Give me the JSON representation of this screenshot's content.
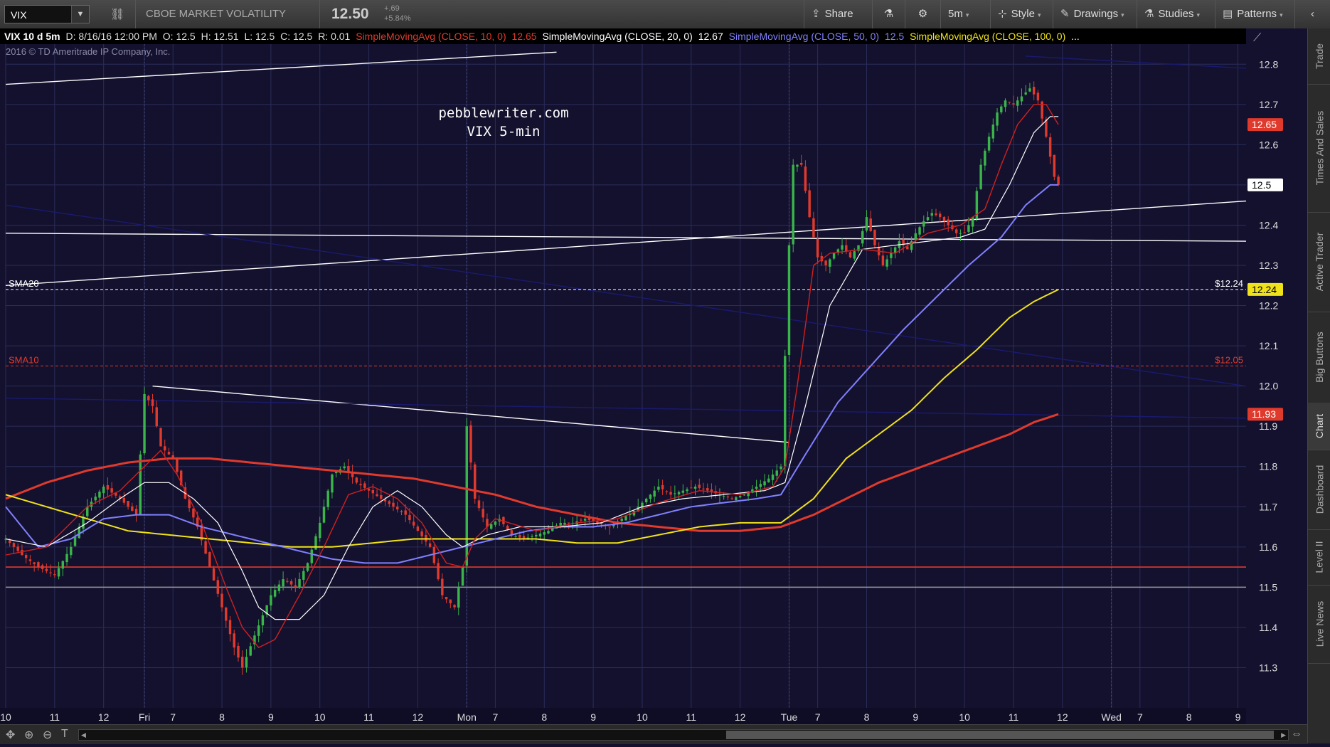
{
  "toolbar": {
    "symbol": "VIX",
    "description": "CBOE MARKET VOLATILITY INDEX",
    "price": "12.50",
    "change": "+.69",
    "change_pct": "+5.84%",
    "buttons": [
      {
        "label": "Share",
        "icon": "share-icon"
      },
      {
        "label": "",
        "icon": "flask-icon"
      },
      {
        "label": "",
        "icon": "gear-icon"
      },
      {
        "label": "5m",
        "icon": ""
      },
      {
        "label": "Style",
        "icon": "style-icon"
      },
      {
        "label": "Drawings",
        "icon": "pencil-icon"
      },
      {
        "label": "Studies",
        "icon": "flask-icon"
      },
      {
        "label": "Patterns",
        "icon": "patterns-icon"
      }
    ]
  },
  "infobar": {
    "symbol_period": "VIX 10 d 5m",
    "date": "D: 8/16/16 12:00 PM",
    "open": "O: 12.5",
    "high": "H: 12.51",
    "low": "L: 12.5",
    "close": "C: 12.5",
    "range": "R: 0.01",
    "sma10_label": "SimpleMovingAvg (CLOSE, 10, 0)",
    "sma10_value": "12.65",
    "sma20_label": "SimpleMovingAvg (CLOSE, 20, 0)",
    "sma20_value": "12.67",
    "sma50_label": "SimpleMovingAvg (CLOSE, 50, 0)",
    "sma50_value": "12.5",
    "sma100_label": "SimpleMovingAvg (CLOSE, 100, 0)",
    "sma100_value": "..."
  },
  "copyright": "2016 © TD Ameritrade IP Company, Inc.",
  "watermark": [
    "pebblewriter.com",
    "VIX 5-min"
  ],
  "right_rail_tabs": [
    "Trade",
    "Times And Sales",
    "Active Trader",
    "Big Buttons",
    "Chart",
    "Dashboard",
    "Level II",
    "Live News"
  ],
  "active_rail_tab": "Chart",
  "chart_data": {
    "type": "candlestick",
    "symbol": "VIX",
    "interval": "5m",
    "ylim": [
      11.2,
      12.85
    ],
    "yticks": [
      11.3,
      11.4,
      11.5,
      11.6,
      11.7,
      11.8,
      11.9,
      12.0,
      12.1,
      12.2,
      12.3,
      12.4,
      12.5,
      12.6,
      12.7,
      12.8
    ],
    "x_ticks": [
      {
        "label": "10",
        "i": 0
      },
      {
        "label": "11",
        "i": 12
      },
      {
        "label": "12",
        "i": 24
      },
      {
        "label": "Fri",
        "i": 34
      },
      {
        "label": "7",
        "i": 41
      },
      {
        "label": "8",
        "i": 53
      },
      {
        "label": "9",
        "i": 65
      },
      {
        "label": "10",
        "i": 77
      },
      {
        "label": "11",
        "i": 89
      },
      {
        "label": "12",
        "i": 101
      },
      {
        "label": "Mon",
        "i": 113
      },
      {
        "label": "7",
        "i": 120
      },
      {
        "label": "8",
        "i": 132
      },
      {
        "label": "9",
        "i": 144
      },
      {
        "label": "10",
        "i": 156
      },
      {
        "label": "11",
        "i": 168
      },
      {
        "label": "12",
        "i": 180
      },
      {
        "label": "Tue",
        "i": 192
      },
      {
        "label": "7",
        "i": 199
      },
      {
        "label": "8",
        "i": 211
      },
      {
        "label": "9",
        "i": 223
      },
      {
        "label": "10",
        "i": 235
      },
      {
        "label": "11",
        "i": 247
      },
      {
        "label": "12",
        "i": 259
      },
      {
        "label": "Wed",
        "i": 271
      },
      {
        "label": "7",
        "i": 278
      },
      {
        "label": "8",
        "i": 290
      },
      {
        "label": "9",
        "i": 302
      }
    ],
    "x_max": 304,
    "session_breaks": [
      34,
      113,
      192,
      271
    ],
    "close_anchors": [
      [
        0,
        11.62
      ],
      [
        4,
        11.58
      ],
      [
        8,
        11.55
      ],
      [
        12,
        11.53
      ],
      [
        16,
        11.6
      ],
      [
        20,
        11.7
      ],
      [
        24,
        11.75
      ],
      [
        28,
        11.72
      ],
      [
        32,
        11.68
      ],
      [
        34,
        11.98
      ],
      [
        36,
        11.95
      ],
      [
        38,
        11.85
      ],
      [
        41,
        11.82
      ],
      [
        44,
        11.72
      ],
      [
        47,
        11.65
      ],
      [
        50,
        11.55
      ],
      [
        53,
        11.45
      ],
      [
        56,
        11.35
      ],
      [
        58,
        11.3
      ],
      [
        61,
        11.38
      ],
      [
        65,
        11.48
      ],
      [
        68,
        11.52
      ],
      [
        71,
        11.5
      ],
      [
        74,
        11.56
      ],
      [
        77,
        11.66
      ],
      [
        80,
        11.78
      ],
      [
        83,
        11.8
      ],
      [
        86,
        11.76
      ],
      [
        89,
        11.74
      ],
      [
        92,
        11.72
      ],
      [
        95,
        11.7
      ],
      [
        98,
        11.68
      ],
      [
        101,
        11.64
      ],
      [
        104,
        11.6
      ],
      [
        107,
        11.48
      ],
      [
        110,
        11.45
      ],
      [
        112,
        11.55
      ],
      [
        113,
        11.9
      ],
      [
        115,
        11.72
      ],
      [
        118,
        11.65
      ],
      [
        121,
        11.67
      ],
      [
        124,
        11.63
      ],
      [
        127,
        11.62
      ],
      [
        130,
        11.63
      ],
      [
        133,
        11.64
      ],
      [
        136,
        11.66
      ],
      [
        139,
        11.66
      ],
      [
        142,
        11.67
      ],
      [
        145,
        11.66
      ],
      [
        148,
        11.65
      ],
      [
        151,
        11.67
      ],
      [
        154,
        11.69
      ],
      [
        157,
        11.72
      ],
      [
        160,
        11.75
      ],
      [
        163,
        11.73
      ],
      [
        166,
        11.74
      ],
      [
        169,
        11.75
      ],
      [
        172,
        11.74
      ],
      [
        175,
        11.73
      ],
      [
        178,
        11.72
      ],
      [
        181,
        11.73
      ],
      [
        184,
        11.75
      ],
      [
        187,
        11.77
      ],
      [
        190,
        11.8
      ],
      [
        192,
        12.35
      ],
      [
        193,
        12.55
      ],
      [
        195,
        12.55
      ],
      [
        197,
        12.42
      ],
      [
        199,
        12.32
      ],
      [
        201,
        12.3
      ],
      [
        203,
        12.33
      ],
      [
        205,
        12.35
      ],
      [
        207,
        12.32
      ],
      [
        209,
        12.35
      ],
      [
        211,
        12.42
      ],
      [
        213,
        12.35
      ],
      [
        215,
        12.3
      ],
      [
        217,
        12.33
      ],
      [
        219,
        12.36
      ],
      [
        221,
        12.34
      ],
      [
        223,
        12.38
      ],
      [
        225,
        12.41
      ],
      [
        227,
        12.43
      ],
      [
        229,
        12.42
      ],
      [
        231,
        12.4
      ],
      [
        233,
        12.38
      ],
      [
        235,
        12.38
      ],
      [
        237,
        12.42
      ],
      [
        239,
        12.55
      ],
      [
        241,
        12.62
      ],
      [
        243,
        12.68
      ],
      [
        245,
        12.71
      ],
      [
        247,
        12.7
      ],
      [
        249,
        12.72
      ],
      [
        251,
        12.74
      ],
      [
        253,
        12.71
      ],
      [
        255,
        12.62
      ],
      [
        257,
        12.52
      ],
      [
        258,
        12.5
      ]
    ],
    "sma10_anchors": [
      [
        0,
        11.58
      ],
      [
        10,
        11.6
      ],
      [
        20,
        11.7
      ],
      [
        28,
        11.74
      ],
      [
        34,
        11.8
      ],
      [
        38,
        11.84
      ],
      [
        42,
        11.78
      ],
      [
        48,
        11.66
      ],
      [
        54,
        11.5
      ],
      [
        58,
        11.4
      ],
      [
        62,
        11.35
      ],
      [
        66,
        11.37
      ],
      [
        72,
        11.48
      ],
      [
        78,
        11.6
      ],
      [
        84,
        11.73
      ],
      [
        90,
        11.75
      ],
      [
        96,
        11.72
      ],
      [
        102,
        11.66
      ],
      [
        108,
        11.56
      ],
      [
        112,
        11.55
      ],
      [
        115,
        11.62
      ],
      [
        120,
        11.67
      ],
      [
        130,
        11.64
      ],
      [
        140,
        11.66
      ],
      [
        150,
        11.67
      ],
      [
        160,
        11.71
      ],
      [
        170,
        11.74
      ],
      [
        180,
        11.73
      ],
      [
        188,
        11.75
      ],
      [
        191,
        11.8
      ],
      [
        194,
        12.0
      ],
      [
        198,
        12.3
      ],
      [
        202,
        12.33
      ],
      [
        210,
        12.34
      ],
      [
        218,
        12.33
      ],
      [
        226,
        12.38
      ],
      [
        234,
        12.4
      ],
      [
        240,
        12.44
      ],
      [
        244,
        12.55
      ],
      [
        248,
        12.65
      ],
      [
        252,
        12.7
      ],
      [
        255,
        12.7
      ],
      [
        258,
        12.65
      ]
    ],
    "sma20_anchors": [
      [
        0,
        11.62
      ],
      [
        10,
        11.6
      ],
      [
        20,
        11.66
      ],
      [
        28,
        11.72
      ],
      [
        34,
        11.76
      ],
      [
        40,
        11.76
      ],
      [
        46,
        11.72
      ],
      [
        52,
        11.66
      ],
      [
        58,
        11.54
      ],
      [
        62,
        11.45
      ],
      [
        66,
        11.42
      ],
      [
        72,
        11.42
      ],
      [
        78,
        11.48
      ],
      [
        84,
        11.6
      ],
      [
        90,
        11.7
      ],
      [
        96,
        11.74
      ],
      [
        102,
        11.7
      ],
      [
        108,
        11.63
      ],
      [
        112,
        11.6
      ],
      [
        118,
        11.63
      ],
      [
        126,
        11.65
      ],
      [
        136,
        11.65
      ],
      [
        146,
        11.66
      ],
      [
        156,
        11.7
      ],
      [
        166,
        11.72
      ],
      [
        176,
        11.73
      ],
      [
        186,
        11.74
      ],
      [
        191,
        11.76
      ],
      [
        196,
        11.95
      ],
      [
        202,
        12.2
      ],
      [
        210,
        12.34
      ],
      [
        218,
        12.35
      ],
      [
        226,
        12.36
      ],
      [
        234,
        12.37
      ],
      [
        240,
        12.39
      ],
      [
        246,
        12.5
      ],
      [
        252,
        12.63
      ],
      [
        256,
        12.67
      ],
      [
        258,
        12.67
      ]
    ],
    "sma50_anchors": [
      [
        0,
        11.7
      ],
      [
        8,
        11.6
      ],
      [
        16,
        11.62
      ],
      [
        24,
        11.67
      ],
      [
        32,
        11.68
      ],
      [
        40,
        11.68
      ],
      [
        48,
        11.65
      ],
      [
        56,
        11.63
      ],
      [
        64,
        11.61
      ],
      [
        72,
        11.59
      ],
      [
        80,
        11.57
      ],
      [
        88,
        11.56
      ],
      [
        96,
        11.56
      ],
      [
        104,
        11.58
      ],
      [
        112,
        11.6
      ],
      [
        120,
        11.62
      ],
      [
        128,
        11.64
      ],
      [
        136,
        11.65
      ],
      [
        144,
        11.65
      ],
      [
        152,
        11.66
      ],
      [
        160,
        11.68
      ],
      [
        168,
        11.7
      ],
      [
        176,
        11.71
      ],
      [
        184,
        11.72
      ],
      [
        190,
        11.73
      ],
      [
        196,
        11.83
      ],
      [
        204,
        11.96
      ],
      [
        212,
        12.05
      ],
      [
        220,
        12.14
      ],
      [
        228,
        12.22
      ],
      [
        236,
        12.3
      ],
      [
        244,
        12.37
      ],
      [
        250,
        12.45
      ],
      [
        256,
        12.5
      ],
      [
        258,
        12.5
      ]
    ],
    "sma100_anchors": [
      [
        0,
        11.73
      ],
      [
        10,
        11.7
      ],
      [
        20,
        11.67
      ],
      [
        30,
        11.64
      ],
      [
        40,
        11.63
      ],
      [
        50,
        11.62
      ],
      [
        60,
        11.61
      ],
      [
        70,
        11.6
      ],
      [
        80,
        11.6
      ],
      [
        90,
        11.61
      ],
      [
        100,
        11.62
      ],
      [
        110,
        11.62
      ],
      [
        120,
        11.62
      ],
      [
        130,
        11.62
      ],
      [
        140,
        11.61
      ],
      [
        150,
        11.61
      ],
      [
        160,
        11.63
      ],
      [
        170,
        11.65
      ],
      [
        180,
        11.66
      ],
      [
        190,
        11.66
      ],
      [
        198,
        11.72
      ],
      [
        206,
        11.82
      ],
      [
        214,
        11.88
      ],
      [
        222,
        11.94
      ],
      [
        230,
        12.02
      ],
      [
        238,
        12.09
      ],
      [
        246,
        12.17
      ],
      [
        252,
        12.21
      ],
      [
        258,
        12.24
      ]
    ],
    "sma200_anchors": [
      [
        0,
        11.72
      ],
      [
        10,
        11.76
      ],
      [
        20,
        11.79
      ],
      [
        30,
        11.81
      ],
      [
        40,
        11.82
      ],
      [
        50,
        11.82
      ],
      [
        60,
        11.81
      ],
      [
        70,
        11.8
      ],
      [
        80,
        11.79
      ],
      [
        90,
        11.78
      ],
      [
        100,
        11.77
      ],
      [
        110,
        11.75
      ],
      [
        120,
        11.73
      ],
      [
        130,
        11.7
      ],
      [
        140,
        11.68
      ],
      [
        150,
        11.66
      ],
      [
        160,
        11.65
      ],
      [
        170,
        11.64
      ],
      [
        180,
        11.64
      ],
      [
        190,
        11.65
      ],
      [
        198,
        11.68
      ],
      [
        206,
        11.72
      ],
      [
        214,
        11.76
      ],
      [
        222,
        11.79
      ],
      [
        230,
        11.82
      ],
      [
        238,
        11.85
      ],
      [
        246,
        11.88
      ],
      [
        252,
        11.91
      ],
      [
        258,
        11.93
      ]
    ],
    "price_labels": [
      {
        "value": "12.65",
        "price": 12.65,
        "bg": "#e03a2d",
        "fg": "#ffffff"
      },
      {
        "value": "12.5",
        "price": 12.5,
        "bg": "#ffffff",
        "fg": "#000000"
      },
      {
        "value": "12.24",
        "price": 12.24,
        "bg": "#f0e21a",
        "fg": "#000000"
      },
      {
        "value": "11.93",
        "price": 11.93,
        "bg": "#e03a2d",
        "fg": "#ffffff"
      }
    ],
    "horizontal_lines": [
      {
        "name": "SMA20",
        "price": 12.24,
        "label_right": "$12.24",
        "color": "#ffffff",
        "dashed": true
      },
      {
        "name": "SMA10",
        "price": 12.05,
        "label_right": "$12.05",
        "color": "#e03a2d",
        "dashed": true
      },
      {
        "name": "",
        "price": 11.55,
        "color": "#e03a2d",
        "dashed": false
      },
      {
        "name": "",
        "price": 11.5,
        "color": "#999999",
        "dashed": false
      }
    ],
    "trendlines": [
      {
        "from": [
          0,
          12.75
        ],
        "to": [
          135,
          12.83
        ],
        "color": "#ffffff"
      },
      {
        "from": [
          0,
          12.25
        ],
        "to": [
          304,
          12.46
        ],
        "color": "#ffffff"
      },
      {
        "from": [
          0,
          12.38
        ],
        "to": [
          304,
          12.36
        ],
        "color": "#ffffff"
      },
      {
        "from": [
          36,
          12.0
        ],
        "to": [
          192,
          11.86
        ],
        "color": "#ffffff"
      },
      {
        "from": [
          0,
          11.97
        ],
        "to": [
          304,
          11.92
        ],
        "color": "#1a1a70"
      },
      {
        "from": [
          0,
          12.45
        ],
        "to": [
          304,
          12.0
        ],
        "color": "#1a1a70"
      },
      {
        "from": [
          250,
          12.82
        ],
        "to": [
          304,
          12.79
        ],
        "color": "#1a1a70"
      }
    ],
    "colors": {
      "up": "#39b54a",
      "down": "#e03a2d",
      "sma10": "#d02020",
      "sma20": "#ffffff",
      "sma50": "#8080ff",
      "sma100": "#f0e21a",
      "sma200": "#e03a2d",
      "background": "#14112e",
      "grid": "#2a2d5a",
      "axis_text": "#dddddd"
    }
  }
}
